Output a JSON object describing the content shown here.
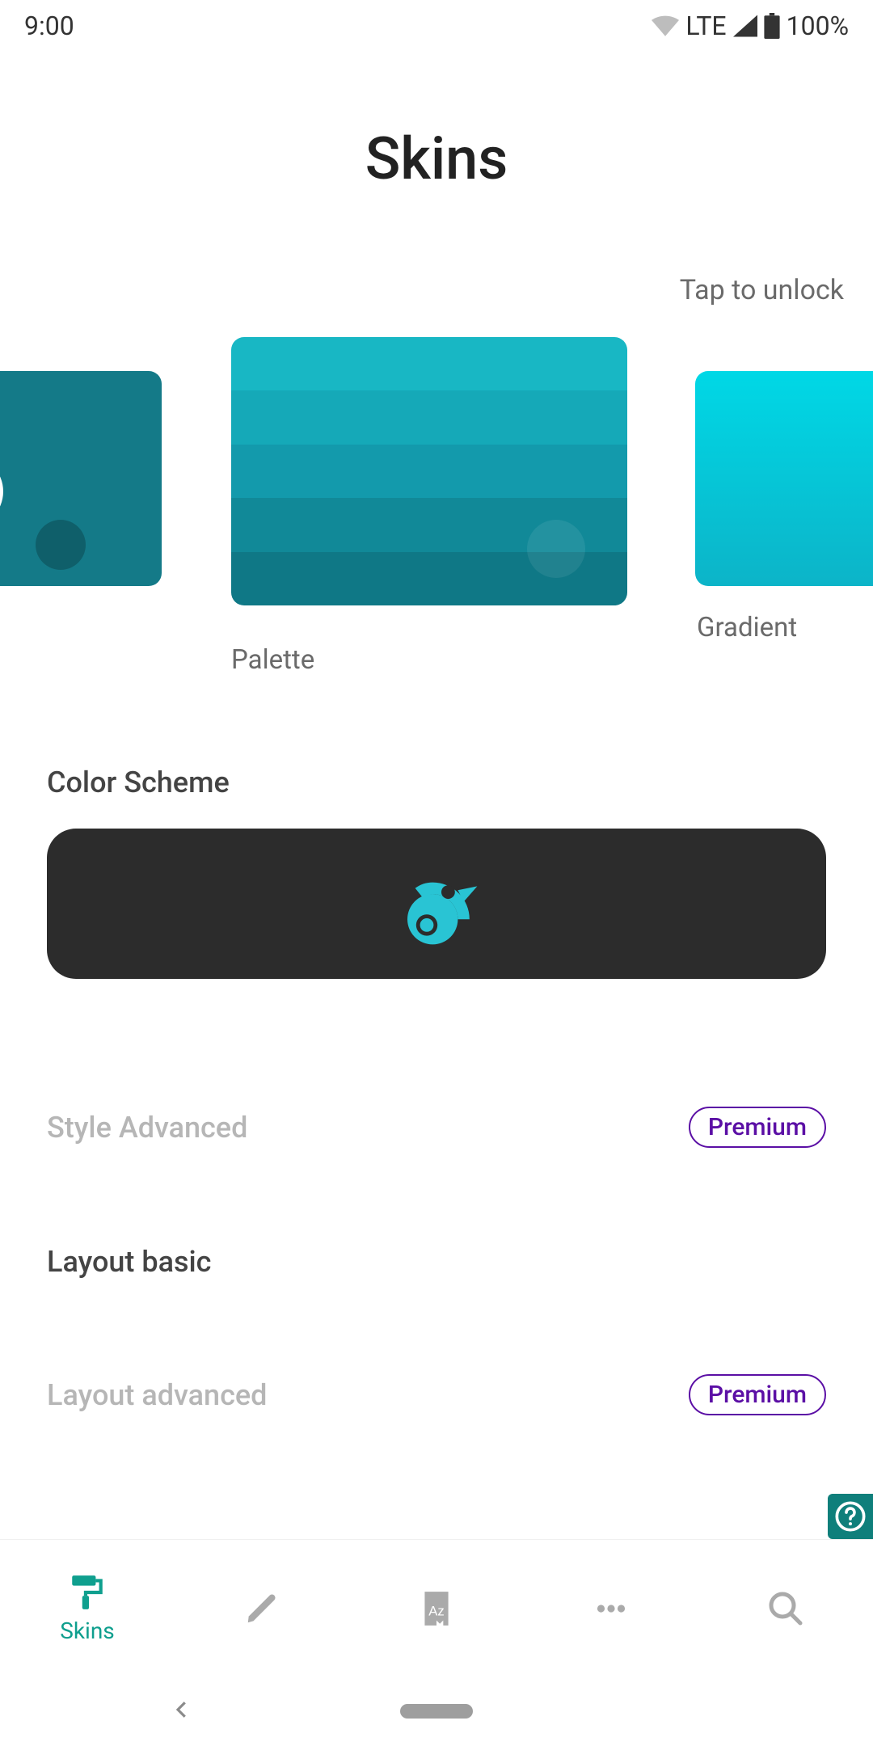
{
  "status_bar": {
    "time": "9:00",
    "network": "LTE",
    "battery": "100%"
  },
  "header": {
    "title": "Skins",
    "unlock_hint": "Tap to unlock"
  },
  "carousel": {
    "items": [
      {
        "label": ""
      },
      {
        "label": "Palette",
        "stripes": [
          "#18b7c4",
          "#15a9b8",
          "#139aac",
          "#118998",
          "#0f7886"
        ]
      },
      {
        "label": "Gradient"
      }
    ]
  },
  "sections": {
    "color_scheme": {
      "title": "Color Scheme"
    },
    "style_advanced": {
      "title": "Style Advanced",
      "badge": "Premium",
      "locked": true
    },
    "layout_basic": {
      "title": "Layout basic",
      "locked": false
    },
    "layout_advanced": {
      "title": "Layout advanced",
      "badge": "Premium",
      "locked": true
    }
  },
  "bottom_nav": {
    "items": [
      {
        "label": "Skins",
        "icon": "paint-roller-icon",
        "active": true
      },
      {
        "label": "",
        "icon": "pencil-icon"
      },
      {
        "label": "",
        "icon": "dictionary-icon"
      },
      {
        "label": "",
        "icon": "more-horizontal-icon"
      },
      {
        "label": "",
        "icon": "search-icon"
      }
    ]
  },
  "colors": {
    "accent": "#0f9f8e",
    "premium": "#5b0fa5",
    "scheme_bg": "#2c2c2c",
    "chameleon": "#29c4d4"
  }
}
